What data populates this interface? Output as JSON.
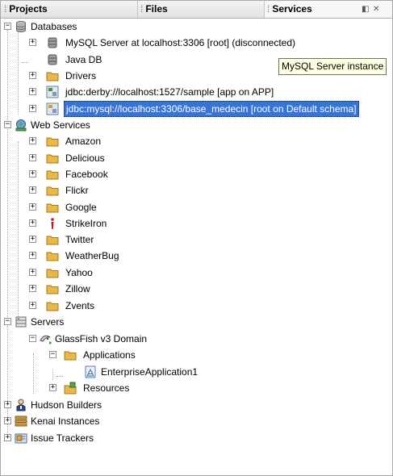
{
  "tabs": {
    "projects": "Projects",
    "files": "Files",
    "services": "Services"
  },
  "tree": {
    "databases": "Databases",
    "mysql_server": "MySQL Server at localhost:3306 [root] (disconnected)",
    "java_db": "Java DB",
    "drivers": "Drivers",
    "derby_conn": "jdbc:derby://localhost:1527/sample [app on APP]",
    "mysql_conn": "jdbc:mysql://localhost:3306/base_medecin [root on Default schema]",
    "web_services": "Web Services",
    "ws": [
      "Amazon",
      "Delicious",
      "Facebook",
      "Flickr",
      "Google",
      "StrikeIron",
      "Twitter",
      "WeatherBug",
      "Yahoo",
      "Zillow",
      "Zvents"
    ],
    "servers": "Servers",
    "glassfish": "GlassFish v3 Domain",
    "applications": "Applications",
    "enterprise_app": "EnterpriseApplication1",
    "resources": "Resources",
    "hudson": "Hudson Builders",
    "kenai": "Kenai Instances",
    "issue_trackers": "Issue Trackers"
  },
  "tooltip": "MySQL Server instance",
  "colors": {
    "selection": "#3874d8",
    "folder": "#e8b84a",
    "tooltip_bg": "#ffffe1"
  }
}
